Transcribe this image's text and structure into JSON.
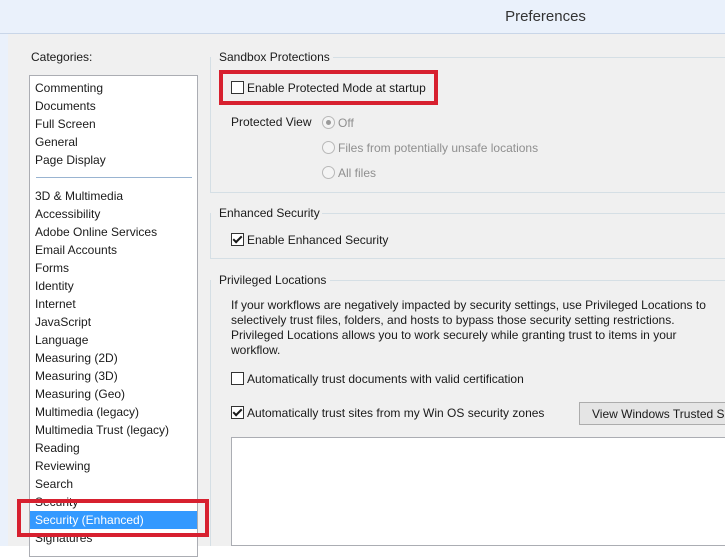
{
  "window": {
    "title": "Preferences"
  },
  "categories": {
    "label": "Categories:",
    "items_group1": [
      "Commenting",
      "Documents",
      "Full Screen",
      "General",
      "Page Display"
    ],
    "items_group2": [
      "3D & Multimedia",
      "Accessibility",
      "Adobe Online Services",
      "Email Accounts",
      "Forms",
      "Identity",
      "Internet",
      "JavaScript",
      "Language",
      "Measuring (2D)",
      "Measuring (3D)",
      "Measuring (Geo)",
      "Multimedia (legacy)",
      "Multimedia Trust (legacy)",
      "Reading",
      "Reviewing",
      "Search",
      "Security",
      "Security (Enhanced)",
      "Signatures"
    ],
    "selected": "Security (Enhanced)"
  },
  "sandbox": {
    "title": "Sandbox Protections",
    "protected_mode_label": "Enable Protected Mode at startup",
    "protected_mode_checked": false,
    "protected_view_label": "Protected View",
    "options": [
      "Off",
      "Files from potentially unsafe locations",
      "All files"
    ],
    "selected_option": "Off"
  },
  "enhanced": {
    "title": "Enhanced Security",
    "enable_label": "Enable Enhanced Security",
    "enable_checked": true
  },
  "privileged": {
    "title": "Privileged Locations",
    "description_lines": [
      "If your workflows are negatively impacted by security settings, use Privileged Locations to",
      "selectively trust files, folders, and hosts to bypass those security setting restrictions.",
      "Privileged Locations allows you to work securely while granting trust to items in your",
      "workflow."
    ],
    "trust_cert_label": "Automatically trust documents with valid certification",
    "trust_cert_checked": false,
    "trust_os_label": "Automatically trust sites from my Win OS security zones",
    "trust_os_checked": true,
    "view_button_label": "View Windows Trusted Sites"
  },
  "colors": {
    "highlight": "#d7202f",
    "selection": "#3399ff"
  }
}
